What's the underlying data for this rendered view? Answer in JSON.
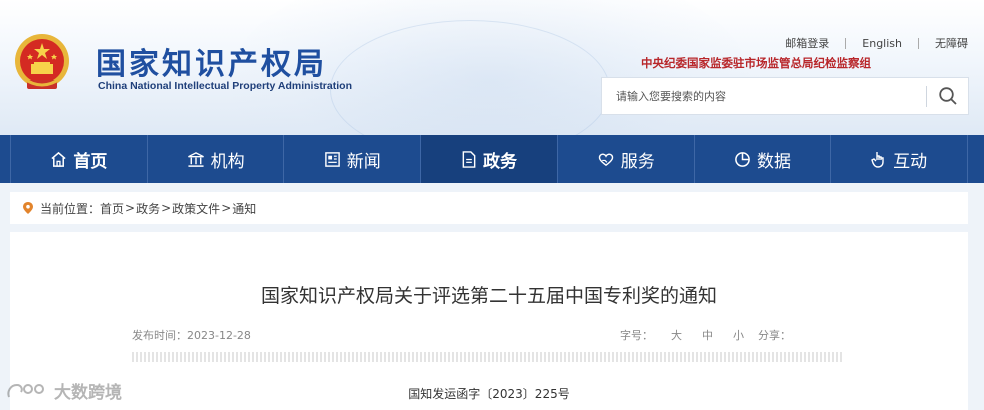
{
  "header": {
    "logo_cn": "国家知识产权局",
    "logo_en": "China National Intellectual Property Administration",
    "top_links": [
      "邮箱登录",
      "English",
      "无障碍"
    ],
    "discipline_office": "中央纪委国家监委驻市场监管总局纪检监察组",
    "search": {
      "placeholder": "请输入您要搜索的内容",
      "icon": "search-icon"
    }
  },
  "nav": {
    "items": [
      {
        "label": "首页",
        "icon": "home-icon"
      },
      {
        "label": "机构",
        "icon": "building-icon"
      },
      {
        "label": "新闻",
        "icon": "newspaper-icon"
      },
      {
        "label": "政务",
        "icon": "document-icon",
        "active": true
      },
      {
        "label": "服务",
        "icon": "heart-hand-icon"
      },
      {
        "label": "数据",
        "icon": "pie-chart-icon"
      },
      {
        "label": "互动",
        "icon": "pointer-hand-icon"
      }
    ]
  },
  "breadcrumb": {
    "prefix": "当前位置：",
    "items": [
      "首页",
      "政务",
      "政策文件",
      "通知"
    ],
    "separator": ">"
  },
  "article": {
    "title": "国家知识产权局关于评选第二十五届中国专利奖的通知",
    "publish_date": "发布时间：2023-12-28",
    "font_size_label": "字号：",
    "font_sizes": [
      "大",
      "中",
      "小"
    ],
    "share_label": "分享：",
    "doc_number": "国知发运函字〔2023〕225号"
  },
  "watermark": "大数跨境",
  "colors": {
    "nav_bg": "#1d4b8f",
    "nav_active": "#17407d",
    "logo_blue": "#1f4fa0",
    "discipline_red": "#b8262a"
  }
}
